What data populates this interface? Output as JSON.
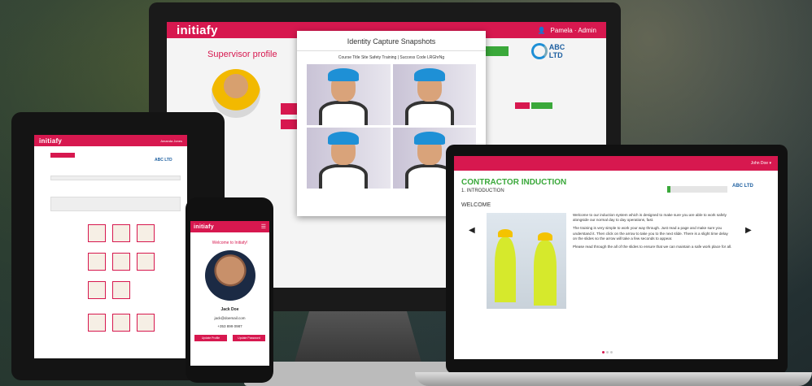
{
  "monitor": {
    "brand": "initiafy",
    "topbar_right": "Pamela · Admin",
    "page_title": "Supervisor profile",
    "modal_title": "Identity Capture Snapshots",
    "modal_subtitle": "Course Title Site Safety Training | Success Code LRGhrNg",
    "company_logo": "ABC LTD"
  },
  "tablet": {
    "brand": "initiafy",
    "user": "Amanda Jones",
    "company_logo": "ABC LTD"
  },
  "phone": {
    "brand": "initiafy",
    "welcome": "Welcome to Initiafy!",
    "name": "Jack Doe",
    "email": "jack@doemail.com",
    "phone": "+353 899 0987",
    "btn_left": "Update Profile",
    "btn_right": "Update Password"
  },
  "laptop": {
    "user": "John Doe ▾",
    "title": "CONTRACTOR INDUCTION",
    "subtitle": "1. INTRODUCTION",
    "section": "WELCOME",
    "company_logo": "ABC LTD",
    "progress": 0.05,
    "para1": "Welcome to our induction system which is designed to make sure you are able to work safely alongside our normal day to day operations, fast.",
    "para2": "The training is very simple to work your way through. Just read a page and make sure you understand it. Then click on the arrow to take you to the next slide. There is a slight time delay on the slides so the arrow will take a few seconds to appear.",
    "para3": "Please read through the all of the slides to ensure that we can maintain a safe work place for all."
  }
}
